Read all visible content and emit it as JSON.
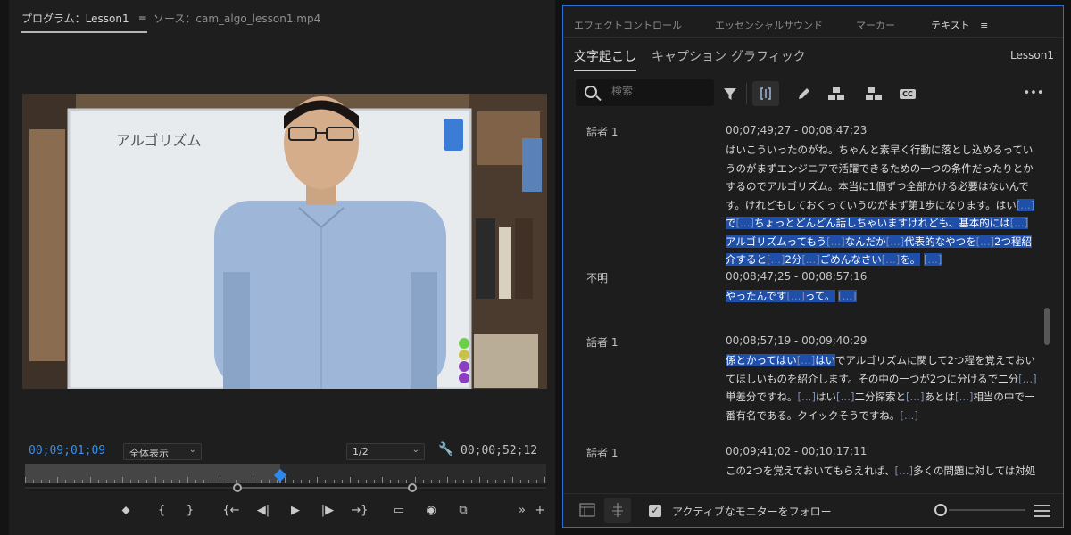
{
  "monitor": {
    "active_tab": "プログラム：Lesson1",
    "menu_glyph": "≡",
    "source_tab": "ソース：cam_algo_lesson1.mp4",
    "timecode_current": "00;09;01;09",
    "fit_select": "全体表示",
    "resolution_select": "1/2",
    "timecode_duration": "00;00;52;12",
    "whiteboard_text": "アルゴリズム",
    "playhead_fraction": 0.49,
    "transport_buttons": [
      {
        "name": "add-marker-button",
        "glyph": "⬥"
      },
      {
        "name": "mark-in-button",
        "glyph": "{"
      },
      {
        "name": "mark-out-button",
        "glyph": "}"
      },
      {
        "name": "go-to-in-button",
        "glyph": "{←"
      },
      {
        "name": "step-back-button",
        "glyph": "◀|"
      },
      {
        "name": "play-button",
        "glyph": "▶"
      },
      {
        "name": "step-forward-button",
        "glyph": "|▶"
      },
      {
        "name": "go-to-out-button",
        "glyph": "→}"
      },
      {
        "name": "safe-margins-button",
        "glyph": "▭"
      },
      {
        "name": "export-frame-button",
        "glyph": "◉"
      },
      {
        "name": "compare-view-button",
        "glyph": "⧉"
      },
      {
        "name": "more-button",
        "glyph": "»"
      },
      {
        "name": "add-button",
        "glyph": "+"
      }
    ]
  },
  "text_panel": {
    "tabs": [
      "エフェクトコントロール",
      "エッセンシャルサウンド",
      "マーカー",
      "テキスト"
    ],
    "active_tab": "テキスト",
    "tab_menu_glyph": "≡",
    "subtabs": [
      "文字起こし",
      "キャプション",
      "グラフィック"
    ],
    "active_subtab": "文字起こし",
    "sequence_name": "Lesson1",
    "search_placeholder": "検索",
    "toolbar_icons": [
      "filter-icon",
      "split-segment-icon",
      "pencil-icon",
      "merge-icon",
      "speaker-icon",
      "cc-icon",
      "more-icon"
    ],
    "cc_label": "CC",
    "more_glyph": "•••",
    "segments": [
      {
        "speaker": "話者 1",
        "time": "00;07;49;27 - 00;08;47;23",
        "text": [
          {
            "t": "はいこういったのがね。ちゃんと素早く行動に落とし込めるっていうのがまずエンジニアで活躍できるための一つの条件だったりとかするのでアルゴリズム。本当に1個ずつ全部かける必要はないんです。けれどもしておくっていうのがまず第1歩になります。はい"
          },
          {
            "t": "[…]",
            "pause": true,
            "hl": true
          },
          {
            "t": "で",
            "hl": true
          },
          {
            "t": "[…]",
            "pause": true,
            "hl": true
          },
          {
            "t": "ちょっとどんどん話しちゃいますけれども、基本的には",
            "hl": true
          },
          {
            "t": "[…]",
            "pause": true,
            "hl": true
          },
          {
            "t": "アルゴリズムってもう",
            "hl": true
          },
          {
            "t": "[…]",
            "pause": true,
            "hl": true
          },
          {
            "t": "なんだか",
            "hl": true
          },
          {
            "t": "[…]",
            "pause": true,
            "hl": true
          },
          {
            "t": "代表的なやつを",
            "hl": true
          },
          {
            "t": "[…]",
            "pause": true,
            "hl": true
          },
          {
            "t": "2つ程紹介すると",
            "hl": true
          },
          {
            "t": "[…]",
            "pause": true,
            "hl": true
          },
          {
            "t": "2分",
            "hl": true
          },
          {
            "t": "[…]",
            "pause": true,
            "hl": true
          },
          {
            "t": "ごめんなさい",
            "hl": true
          },
          {
            "t": "[…]",
            "pause": true,
            "hl": true
          },
          {
            "t": "を。",
            "hl": true
          },
          {
            "t": " "
          },
          {
            "t": "[…]",
            "pause": true,
            "hl": true
          }
        ]
      },
      {
        "speaker": "不明",
        "time": "00;08;47;25 - 00;08;57;16",
        "text": [
          {
            "t": "やったんです",
            "hl": true
          },
          {
            "t": "[…]",
            "pause": true,
            "hl": true
          },
          {
            "t": "って。",
            "hl": true
          },
          {
            "t": " "
          },
          {
            "t": "[…]",
            "pause": true,
            "hl": true
          }
        ]
      },
      {
        "speaker": "話者 1",
        "time": "00;08;57;19 - 00;09;40;29",
        "text": [
          {
            "t": "係とかってはい",
            "hl": true
          },
          {
            "t": "[…]",
            "pause": true,
            "hl": true
          },
          {
            "t": "はい",
            "hl": true
          },
          {
            "t": "でアルゴリズムに関して2つ程を覚えておいてほしいものを紹介します。その中の一つが2つに分けるで二分"
          },
          {
            "t": "[…]",
            "pause": true
          },
          {
            "t": "単差分ですね。"
          },
          {
            "t": "[…]",
            "pause": true
          },
          {
            "t": "はい"
          },
          {
            "t": "[…]",
            "pause": true
          },
          {
            "t": "二分探索と"
          },
          {
            "t": "[…]",
            "pause": true
          },
          {
            "t": "あとは"
          },
          {
            "t": "[…]",
            "pause": true
          },
          {
            "t": "相当の中で一番有名である。クイックそうですね。"
          },
          {
            "t": "[…]",
            "pause": true
          }
        ]
      },
      {
        "speaker": "話者 1",
        "time": "00;09;41;02 - 00;10;17;11",
        "text": [
          {
            "t": "この2つを覚えておいてもらえれば、"
          },
          {
            "t": "[…]",
            "pause": true
          },
          {
            "t": "多くの問題に対しては対処できるのではないかなと思っております。そしてまた分けるということです。"
          }
        ]
      }
    ],
    "follow_label": "アクティブなモニターをフォロー",
    "follow_checked": true,
    "check_glyph": "✓"
  }
}
